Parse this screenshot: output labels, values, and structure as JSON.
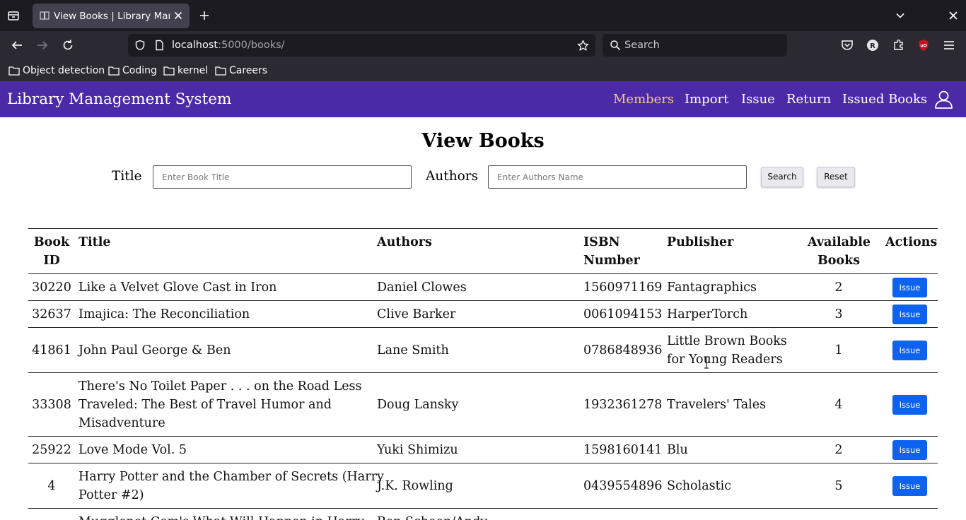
{
  "browser": {
    "tab_title": "View Books | Library Management System",
    "url_host": "localhost",
    "url_rest": ":5000/books/",
    "search_placeholder": "Search",
    "profile_initial": "R",
    "bookmarks": [
      {
        "label": "Object detection"
      },
      {
        "label": "Coding"
      },
      {
        "label": "kernel"
      },
      {
        "label": "Careers"
      }
    ]
  },
  "app": {
    "brand": "Library Management System",
    "nav": [
      {
        "label": "Members",
        "active": true
      },
      {
        "label": "Import"
      },
      {
        "label": "Issue"
      },
      {
        "label": "Return"
      },
      {
        "label": "Issued Books"
      }
    ]
  },
  "page": {
    "title": "View Books",
    "title_label": "Title",
    "title_placeholder": "Enter Book Title",
    "authors_label": "Authors",
    "authors_placeholder": "Enter Authors Name",
    "search_button": "Search",
    "reset_button": "Reset"
  },
  "table": {
    "headers": {
      "book_id": [
        "Book",
        "ID"
      ],
      "title": "Title",
      "authors": "Authors",
      "isbn": [
        "ISBN",
        "Number"
      ],
      "publisher": "Publisher",
      "available": [
        "Available",
        "Books"
      ],
      "actions": "Actions"
    },
    "rows": [
      {
        "id": "30220",
        "title": [
          "Like a Velvet Glove Cast in Iron"
        ],
        "authors": [
          "Daniel Clowes"
        ],
        "isbn": "1560971169",
        "publisher": [
          "Fantagraphics"
        ],
        "available": "2",
        "action": "Issue"
      },
      {
        "id": "32637",
        "title": [
          "Imajica: The Reconciliation"
        ],
        "authors": [
          "Clive Barker"
        ],
        "isbn": "0061094153",
        "publisher": [
          "HarperTorch"
        ],
        "available": "3",
        "action": "Issue"
      },
      {
        "id": "41861",
        "title": [
          "John Paul George & Ben"
        ],
        "authors": [
          "Lane Smith"
        ],
        "isbn": "0786848936",
        "publisher": [
          "Little Brown Books",
          "for Young Readers"
        ],
        "available": "1",
        "action": "Issue"
      },
      {
        "id": "33308",
        "title": [
          "There's No Toilet Paper . . . on the Road Less",
          "Traveled: The Best of Travel Humor and",
          "Misadventure"
        ],
        "authors": [
          "Doug Lansky"
        ],
        "isbn": "1932361278",
        "publisher": [
          "Travelers' Tales"
        ],
        "available": "4",
        "action": "Issue"
      },
      {
        "id": "25922",
        "title": [
          "Love Mode Vol. 5"
        ],
        "authors": [
          "Yuki Shimizu"
        ],
        "isbn": "1598160141",
        "publisher": [
          "Blu"
        ],
        "available": "2",
        "action": "Issue"
      },
      {
        "id": "4",
        "title": [
          "Harry Potter and the Chamber of Secrets (Harry",
          "Potter #2)"
        ],
        "authors": [
          "J.K. Rowling"
        ],
        "isbn": "0439554896",
        "publisher": [
          "Scholastic"
        ],
        "available": "5",
        "action": "Issue"
      },
      {
        "id": "",
        "title": [
          "Mugglenet.Com's What Will Happen in Harry"
        ],
        "authors": [
          "Ben Schoen/Andy"
        ],
        "isbn": "",
        "publisher": [
          ""
        ],
        "available": "",
        "action": ""
      }
    ]
  }
}
